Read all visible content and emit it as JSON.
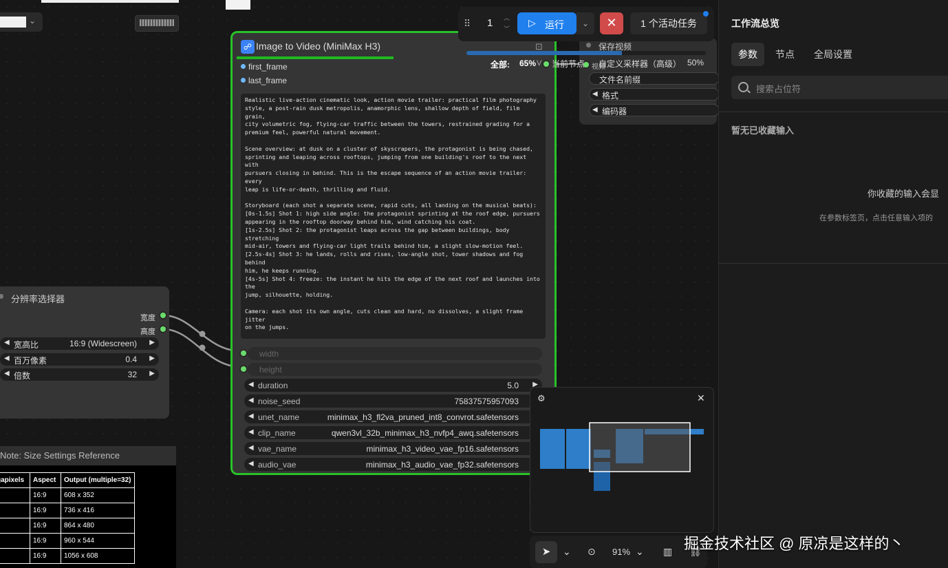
{
  "toolbar": {
    "queue_count": "1",
    "run_label": "运行",
    "active_tasks": "1 个活动任务",
    "progress_total_label": "全部:",
    "progress_total_value": "65%",
    "progress_fraction": 0.65,
    "current_node_label": "当前节点",
    "sampler_text": "自定义采样器（高级）",
    "sampler_percent": "50%"
  },
  "resolution_node": {
    "title": "分辨率选择器",
    "outputs": [
      "宽度",
      "高度"
    ],
    "widgets": [
      {
        "label": "宽高比",
        "value": "16:9 (Widescreen)"
      },
      {
        "label": "百万像素",
        "value": "0.4"
      },
      {
        "label": "倍数",
        "value": "32"
      }
    ]
  },
  "note": {
    "title": "Note: Size Settings Reference",
    "headers": [
      "gapixels",
      "Aspect",
      "Output (multiple=32)"
    ],
    "rows": [
      [
        "",
        "16:9",
        "608 x 352"
      ],
      [
        "",
        "16:9",
        "736 x 416"
      ],
      [
        "",
        "16:9",
        "864 x 480"
      ],
      [
        "",
        "16:9",
        "960 x 544"
      ],
      [
        "",
        "16:9",
        "1056 x 608"
      ]
    ]
  },
  "main_node": {
    "title": "Image to Video (MiniMax H3)",
    "inputs": [
      "first_frame",
      "last_frame"
    ],
    "prompt": "Realistic live-action cinematic look, action movie trailer: practical film photography\nstyle, a post-rain dusk metropolis, anamorphic lens, shallow depth of field, film grain,\ncity volumetric fog, flying-car traffic between the towers, restrained grading for a\npremium feel, powerful natural movement.\n\nScene overview: at dusk on a cluster of skyscrapers, the protagonist is being chased,\nsprinting and leaping across rooftops, jumping from one building's roof to the next with\npursuers closing in behind. This is the escape sequence of an action movie trailer: every\nleap is life-or-death, thrilling and fluid.\n\nStoryboard (each shot a separate scene, rapid cuts, all landing on the musical beats):\n[0s-1.5s] Shot 1: high side angle: the protagonist sprinting at the roof edge, pursuers\nappearing in the rooftop doorway behind him, wind catching his coat.\n[1s-2.5s] Shot 2: the protagonist leaps across the gap between buildings, body stretching\nmid-air, towers and flying-car light trails behind him, a slight slow-motion feel.\n[2.5s-4s] Shot 3: he lands, rolls and rises, low-angle shot, tower shadows and fog behind\nhim, he keeps running.\n[4s-5s] Shot 4: freeze: the instant he hits the edge of the next roof and launches into the\njump, silhouette, holding.\n\nCamera: each shot its own angle, cuts clean and hard, no dissolves, a slight frame jitter\non the jumps.\n\nAudio: wind, rapid footsteps, city ambience, low score underneath, an accent hit on each\nleap, the score bursting at 4s, closing the last 1s.\n\nNo text, subtitles, logos or watermarks of any kind, no animation or cartoon rendering, no\noverly-CG look, keep the live-action texture.",
    "converted_widgets": [
      "width",
      "height"
    ],
    "widgets": [
      {
        "label": "duration",
        "value": "5.0"
      },
      {
        "label": "noise_seed",
        "value": "75837575957093"
      },
      {
        "label": "unet_name",
        "value": "minimax_h3_fl2va_pruned_int8_convrot.safetensors"
      },
      {
        "label": "clip_name",
        "value": "qwen3vl_32b_minimax_h3_nvfp4_awq.safetensors"
      },
      {
        "label": "vae_name",
        "value": "minimax_h3_video_vae_fp16.safetensors"
      },
      {
        "label": "audio_vae",
        "value": "minimax_h3_audio_vae_fp32.safetensors"
      }
    ],
    "output_label": "V"
  },
  "save_node": {
    "title": "保存视频",
    "input_label": "视频",
    "widgets": [
      "文件名前缀",
      "格式",
      "编码器"
    ]
  },
  "panel": {
    "title": "工作流总览",
    "tabs": [
      "参数",
      "节点",
      "全局设置"
    ],
    "search_placeholder": "搜索占位符",
    "empty_title": "暂无已收藏输入",
    "empty_heading": "你收藏的输入会显",
    "empty_hint": "在参数标签页，点击任意输入项的"
  },
  "bottom": {
    "zoom": "91%"
  },
  "watermark": "掘金技术社区 @ 原凉是这样的丶",
  "colors": {
    "accent": "#2080ee",
    "node_border_running": "#29c229",
    "stop": "#d14b4b",
    "port_green": "#6bdc6b",
    "port_blue": "#6fb9ff"
  }
}
